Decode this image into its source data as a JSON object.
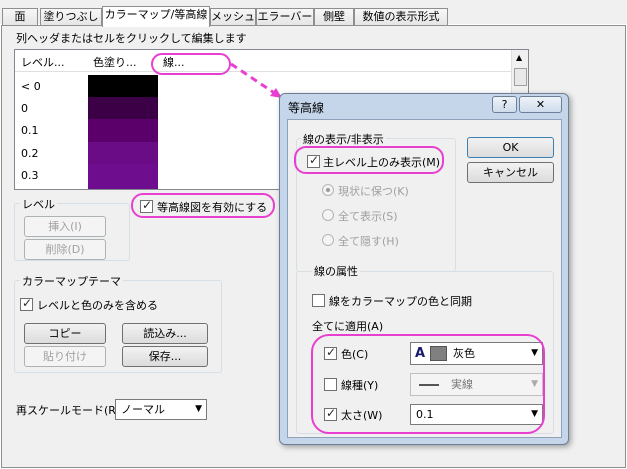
{
  "tabs": [
    "面",
    "塗りつぶし",
    "カラーマップ/等高線",
    "メッシュ",
    "エラーバー",
    "側壁",
    "数値の表示形式"
  ],
  "grid": {
    "instruction": "列ヘッダまたはセルをクリックして編集します",
    "headers": {
      "level": "レベル...",
      "fill": "色塗り...",
      "line": "線..."
    },
    "rows": [
      {
        "label": "< 0",
        "color": "#000000"
      },
      {
        "label": "0",
        "color": "#3c0046"
      },
      {
        "label": "0.1",
        "color": "#5b006b"
      },
      {
        "label": "0.2",
        "color": "#6a0c85"
      },
      {
        "label": "0.3",
        "color": "#6f0d8f"
      }
    ]
  },
  "levels": {
    "group": "レベル",
    "insert": "挿入(I)",
    "delete": "削除(D)"
  },
  "enable_contour": "等高線図を有効にする",
  "theme": {
    "group": "カラーマップテーマ",
    "include_label": "レベルと色のみを含める",
    "copy": "コピー",
    "load": "読込み...",
    "paste": "貼り付け",
    "save": "保存..."
  },
  "rescale": {
    "label": "再スケールモード(R)",
    "value": "ノーマル"
  },
  "dialog": {
    "title": "等高線",
    "help": "?",
    "close": "✕",
    "show_group": "線の表示/非表示",
    "major_only": "主レベル上のみ表示(M)",
    "keep": "現状に保つ(K)",
    "show_all": "全て表示(S)",
    "hide_all": "全て隠す(H)",
    "ok": "OK",
    "cancel": "キャンセル",
    "attr_group": "線の属性",
    "sync": "線をカラーマップの色と同期",
    "apply_all": "全てに適用(A)",
    "color_label": "色(C)",
    "color_value": "灰色",
    "color_icon": "A",
    "linetype_label": "線種(Y)",
    "linetype_value": "実線",
    "width_label": "太さ(W)",
    "width_value": "0.1"
  },
  "colors": {
    "highlight": "#e83fd0",
    "swatch": "#808080"
  }
}
